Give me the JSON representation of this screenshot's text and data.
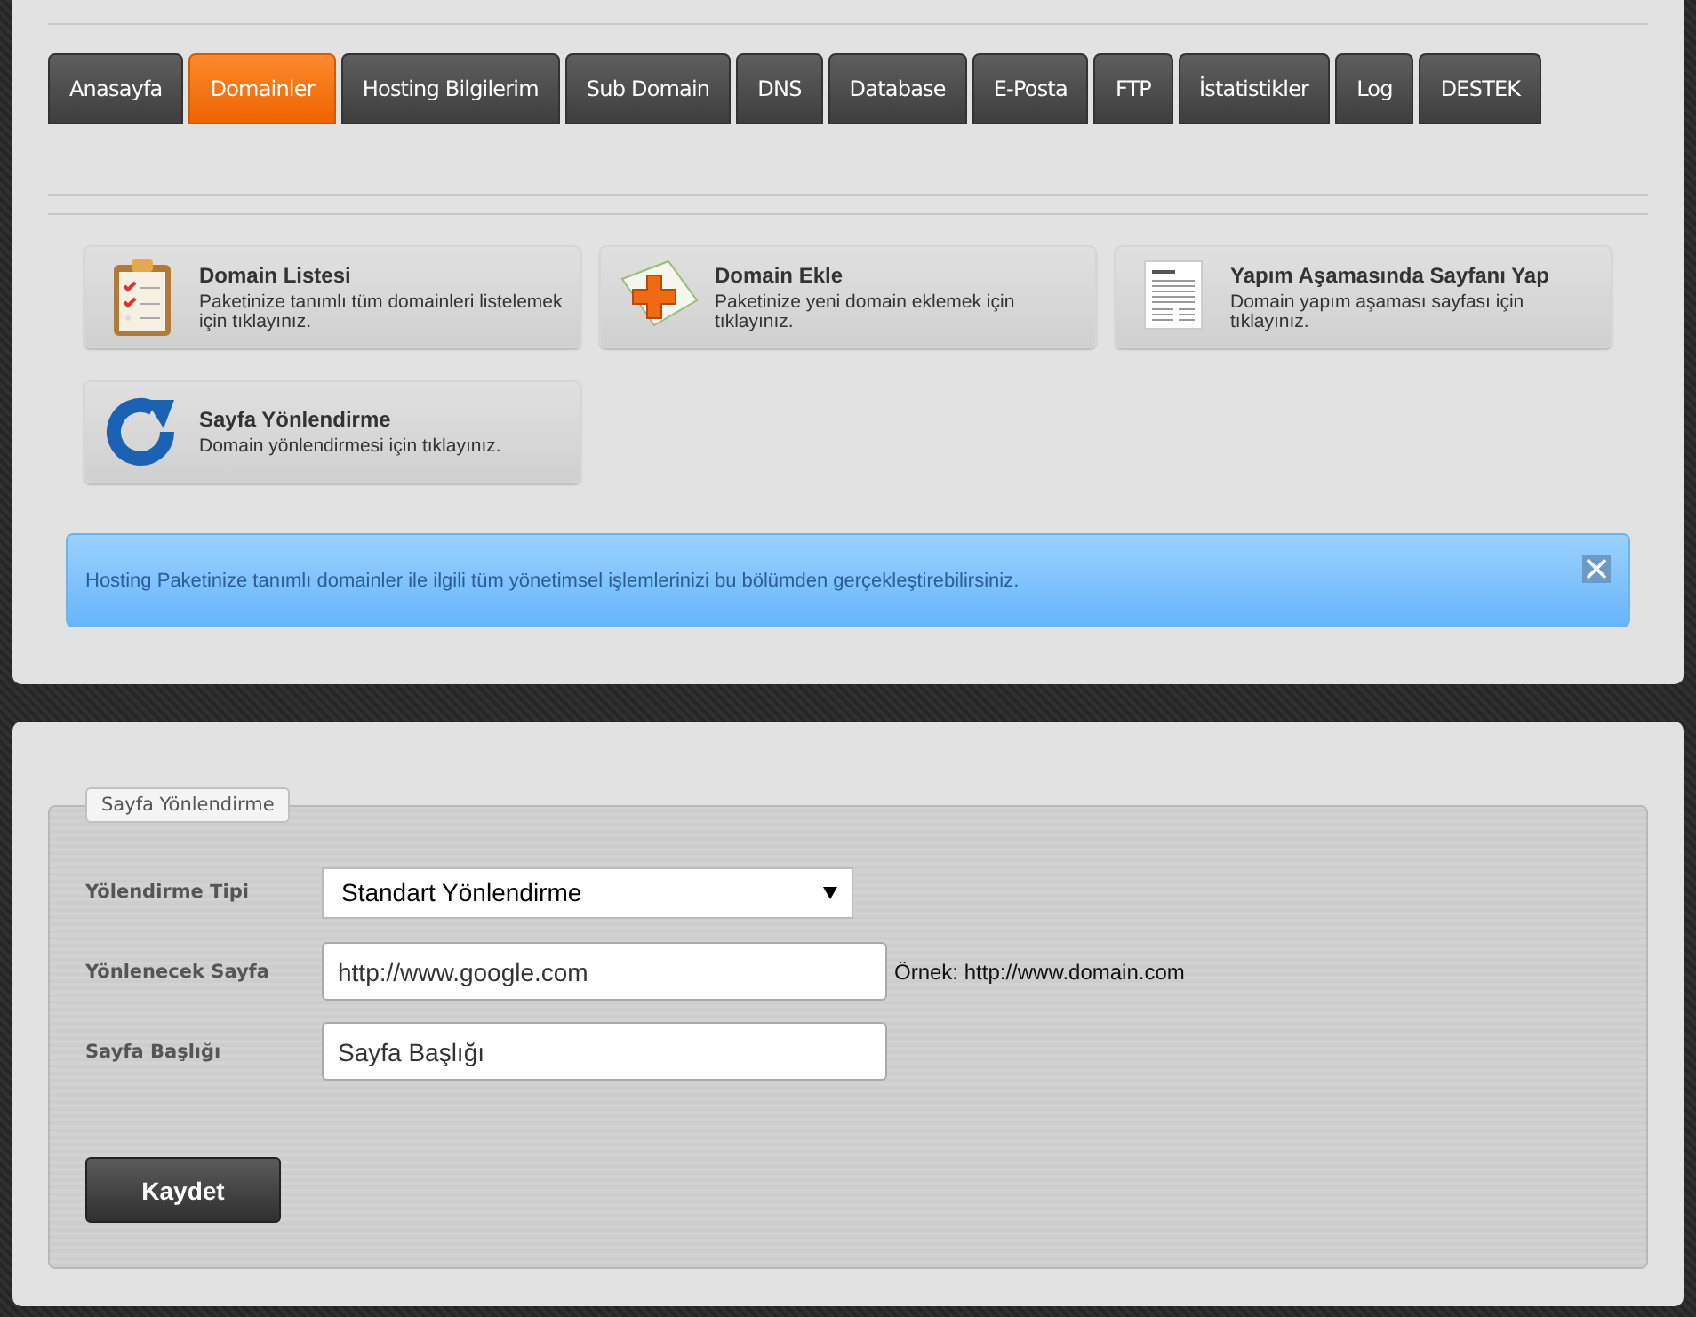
{
  "tabs": [
    {
      "label": "Anasayfa",
      "selected": false
    },
    {
      "label": "Domainler",
      "selected": true
    },
    {
      "label": "Hosting Bilgilerim",
      "selected": false
    },
    {
      "label": "Sub Domain",
      "selected": false
    },
    {
      "label": "DNS",
      "selected": false
    },
    {
      "label": "Database",
      "selected": false
    },
    {
      "label": "E-Posta",
      "selected": false
    },
    {
      "label": "FTP",
      "selected": false
    },
    {
      "label": "İstatistikler",
      "selected": false
    },
    {
      "label": "Log",
      "selected": false
    },
    {
      "label": "DESTEK",
      "selected": false
    }
  ],
  "shortcuts": [
    {
      "kind": "clipboard",
      "title": "Domain Listesi",
      "description": "Paketinize tanımlı tüm domainleri listelemek için tıklayınız."
    },
    {
      "kind": "add",
      "title": "Domain Ekle",
      "description": "Paketinize yeni domain eklemek için tıklayınız."
    },
    {
      "kind": "document",
      "title": "Yapım Aşamasında Sayfanı Yap",
      "description": "Domain yapım aşaması sayfası için tıklayınız."
    },
    {
      "kind": "redirect",
      "title": "Sayfa Yönlendirme",
      "description": "Domain yönlendirmesi için tıklayınız."
    }
  ],
  "alert": {
    "message": "Hosting Paketinize tanımlı domainler ile ilgili tüm yönetimsel işlemlerinizi bu bölümden gerçekleştirebilirsiniz.",
    "closable": true
  },
  "form": {
    "legend": "Sayfa Yönlendirme",
    "fields": [
      {
        "kind": "select",
        "label": "Yölendirme Tipi",
        "value": "Standart Yönlendirme"
      },
      {
        "kind": "text",
        "label": "Yönlenecek Sayfa",
        "value": "http://www.google.com",
        "hint": "Örnek: http://www.domain.com"
      },
      {
        "kind": "text",
        "label": "Sayfa Başlığı",
        "value": "Sayfa Başlığı"
      }
    ],
    "submit": "Kaydet"
  }
}
